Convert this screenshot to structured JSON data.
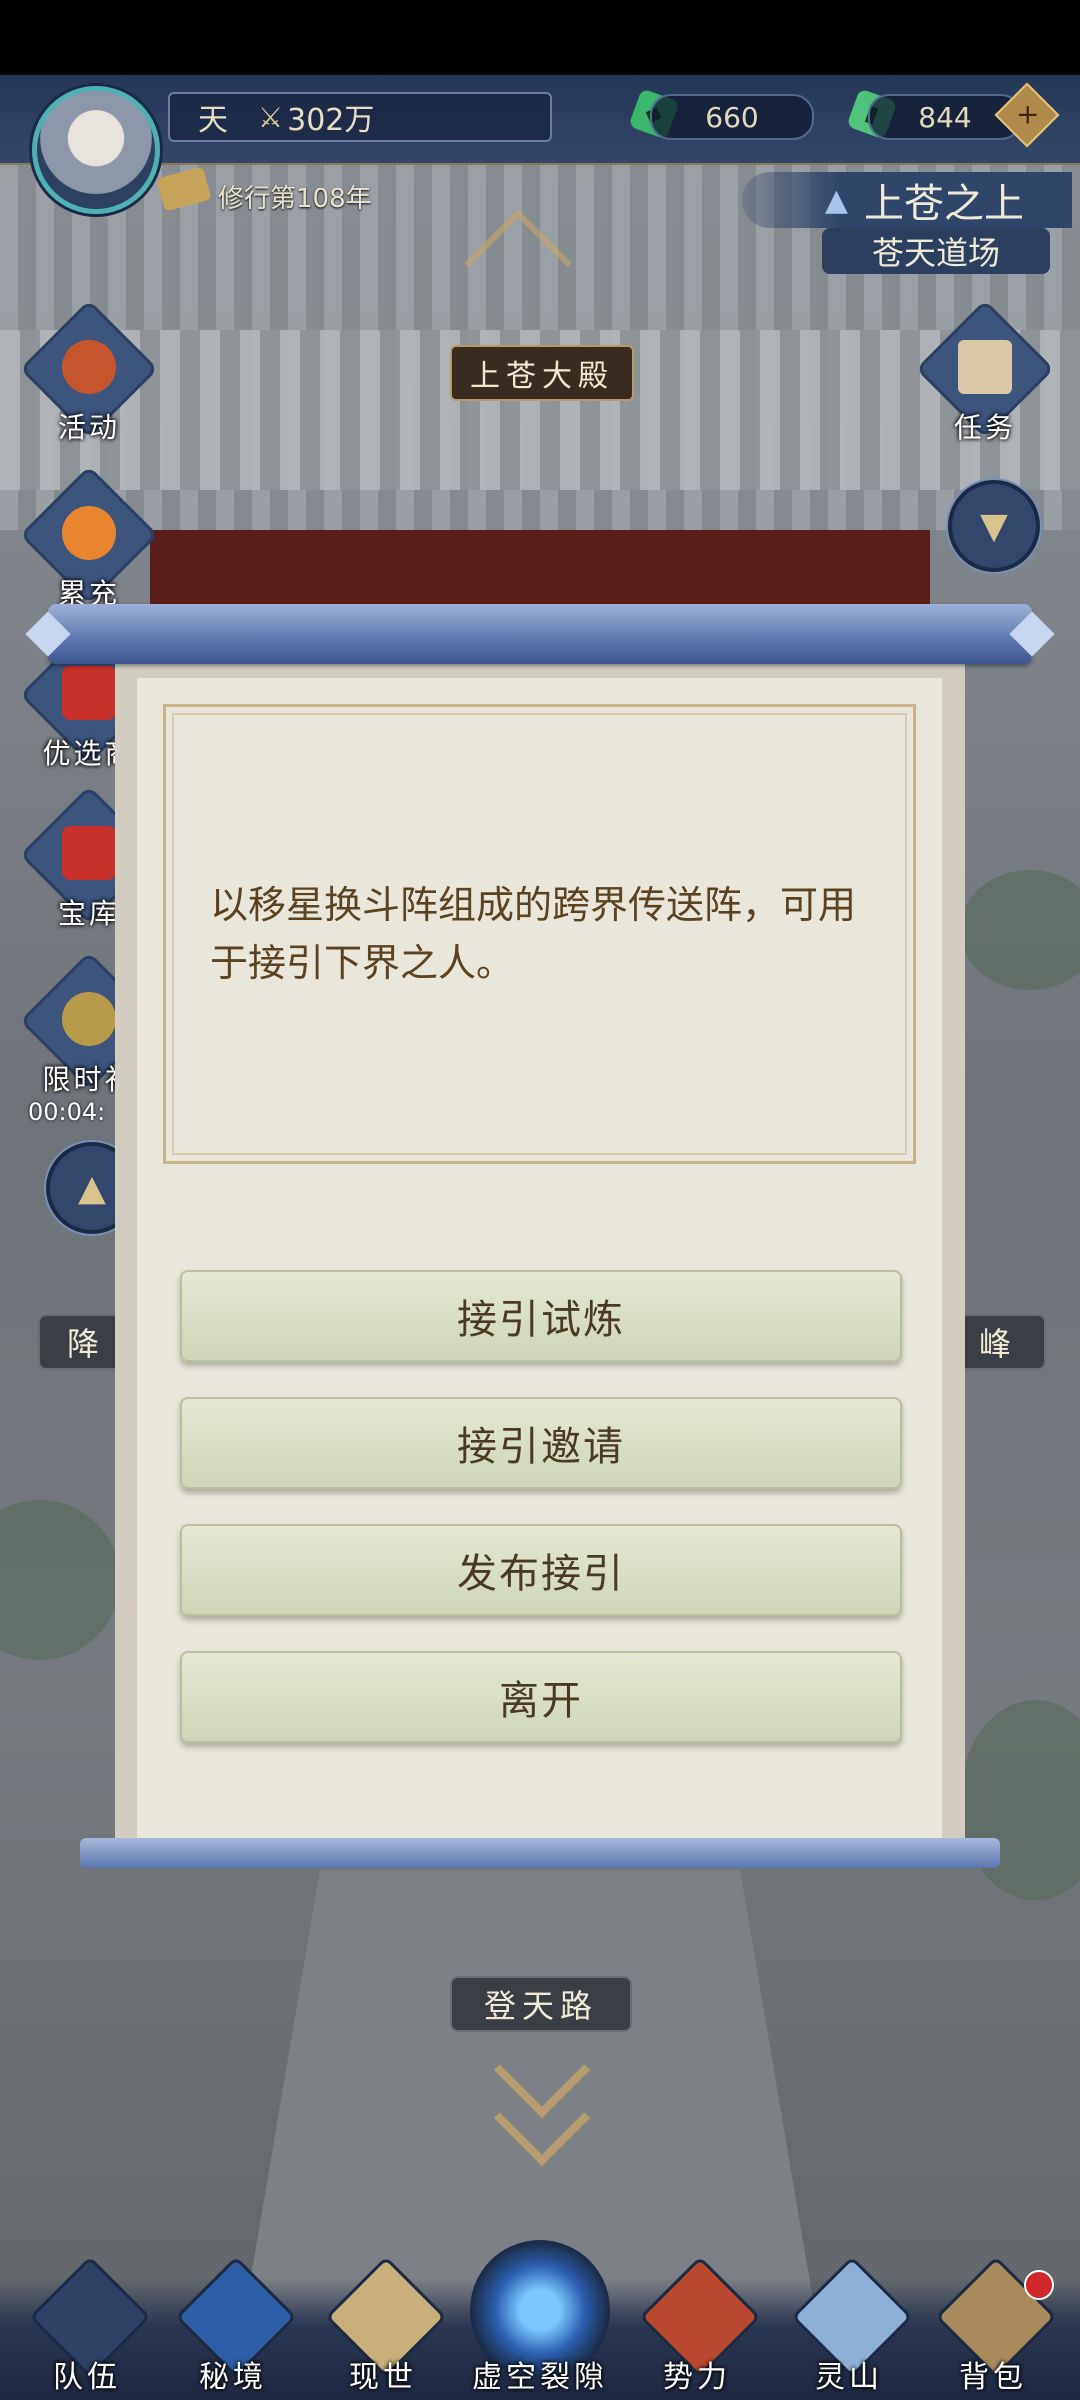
{
  "header": {
    "realm_prefix": "天",
    "power_value": "302万",
    "currency_1": "660",
    "currency_2": "844",
    "plus_label": "+",
    "cultivation_year": "修行第108年",
    "location_main": "上苍之上",
    "location_sub": "苍天道场"
  },
  "scene": {
    "hall_name": "上苍大殿",
    "road_name": "登天路",
    "left_tag": "降",
    "right_tag": "峰"
  },
  "side_left": [
    {
      "label": "活动",
      "icon": "lantern-icon"
    },
    {
      "label": "累充",
      "icon": "lantern-icon"
    },
    {
      "label": "优选商",
      "icon": "gift-box-icon"
    },
    {
      "label": "宝库",
      "icon": "treasure-chest-icon"
    },
    {
      "label": "限时礼",
      "icon": "money-bag-icon"
    }
  ],
  "side_right": [
    {
      "label": "任务",
      "icon": "scroll-icon"
    }
  ],
  "timer": "00:04:",
  "dialog": {
    "description": "以移星换斗阵组成的跨界传送阵，可用于接引下界之人。",
    "options": [
      "接引试炼",
      "接引邀请",
      "发布接引",
      "离开"
    ]
  },
  "bottom_nav": [
    {
      "label": "队伍",
      "icon": "hero-icon"
    },
    {
      "label": "秘境",
      "icon": "vortex-icon"
    },
    {
      "label": "现世",
      "icon": "map-scroll-icon"
    },
    {
      "label": "虚空裂隙",
      "icon": "portal-icon"
    },
    {
      "label": "势力",
      "icon": "palace-icon"
    },
    {
      "label": "灵山",
      "icon": "mountain-icon"
    },
    {
      "label": "背包",
      "icon": "bag-icon"
    }
  ],
  "colors": {
    "accent_gold": "#c9a86a",
    "dialog_text": "#5b4220",
    "button_green": "#cfd6b9",
    "notification_red": "#d0282a"
  }
}
